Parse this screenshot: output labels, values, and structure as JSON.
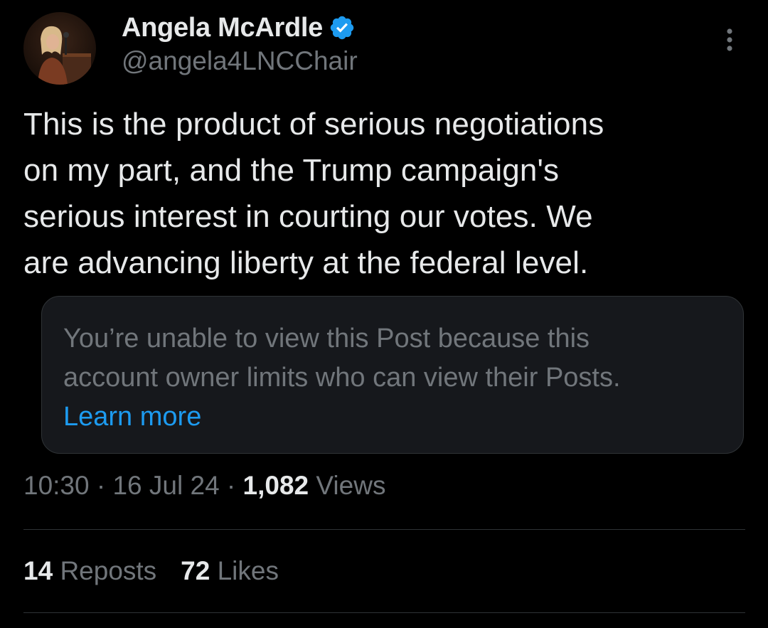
{
  "author": {
    "display_name": "Angela McArdle",
    "handle": "@angela4LNCChair",
    "verified": true,
    "avatar_icon": "profile-photo",
    "verified_icon": "verified-badge-icon",
    "verified_color": "#1d9bf0"
  },
  "menu": {
    "icon": "more-options-icon"
  },
  "post": {
    "text": "This is the product of serious negotiations\non my part, and the Trump campaign's\nserious interest in courting our votes. We\nare advancing liberty at the federal level."
  },
  "quote": {
    "message": "You’re unable to view this Post because this\naccount owner limits who can view their Posts.",
    "link_label": "Learn more"
  },
  "meta": {
    "time": "10:30",
    "separator": " · ",
    "date": "16 Jul 24",
    "views_count": "1,082",
    "views_label": "Views"
  },
  "stats": {
    "reposts_count": "14",
    "reposts_label": "Reposts",
    "likes_count": "72",
    "likes_label": "Likes"
  },
  "colors": {
    "background": "#000000",
    "primary_text": "#e7e9ea",
    "secondary_text": "#71767b",
    "link": "#1d9bf0",
    "card_background": "#16181c",
    "border": "#2f3336"
  }
}
